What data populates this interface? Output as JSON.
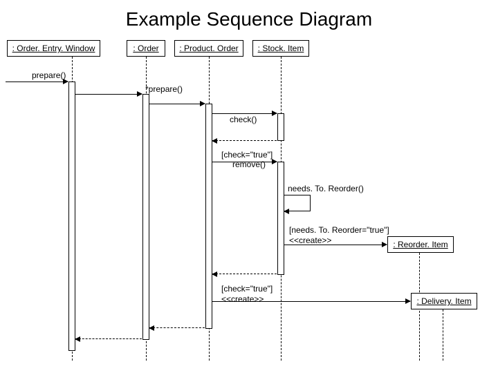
{
  "title": "Example Sequence Diagram",
  "participants": {
    "oew": ": Order. Entry. Window",
    "order": ": Order",
    "productOrder": ": Product. Order",
    "stockItem": ": Stock. Item",
    "reorderItem": ": Reorder. Item",
    "deliveryItem": ": Delivery. Item"
  },
  "messages": {
    "m1": "prepare()",
    "m2": "*prepare()",
    "m3": "check()",
    "m4_guard": "[check=\"true\"]",
    "m4": "remove()",
    "m5": "needs. To. Reorder()",
    "m6_guard": "[needs. To. Reorder=\"true\"]",
    "m6": "<<create>>",
    "m7_guard": "[check=\"true\"]",
    "m7": "<<create>>"
  },
  "chart_data": {
    "type": "sequence_diagram",
    "participants": [
      "Order.Entry.Window",
      "Order",
      "Product.Order",
      "Stock.Item",
      "Reorder.Item",
      "Delivery.Item"
    ],
    "messages": [
      {
        "from": "external",
        "to": "Order.Entry.Window",
        "label": "prepare()",
        "type": "sync"
      },
      {
        "from": "Order.Entry.Window",
        "to": "Order",
        "label": "*prepare()",
        "type": "sync"
      },
      {
        "from": "Order",
        "to": "Product.Order",
        "label": "",
        "type": "sync"
      },
      {
        "from": "Product.Order",
        "to": "Stock.Item",
        "label": "check()",
        "type": "sync"
      },
      {
        "from": "Product.Order",
        "to": "Stock.Item",
        "label": "remove()",
        "guard": "[check=\"true\"]",
        "type": "sync"
      },
      {
        "from": "Stock.Item",
        "to": "Stock.Item",
        "label": "needs.To.Reorder()",
        "type": "self"
      },
      {
        "from": "Stock.Item",
        "to": "Reorder.Item",
        "label": "<<create>>",
        "guard": "[needs.To.Reorder=\"true\"]",
        "type": "create"
      },
      {
        "from": "Product.Order",
        "to": "Delivery.Item",
        "label": "<<create>>",
        "guard": "[check=\"true\"]",
        "type": "create"
      },
      {
        "from": "Product.Order",
        "to": "Order",
        "label": "",
        "type": "return"
      },
      {
        "from": "Order",
        "to": "Order.Entry.Window",
        "label": "",
        "type": "return"
      }
    ]
  }
}
